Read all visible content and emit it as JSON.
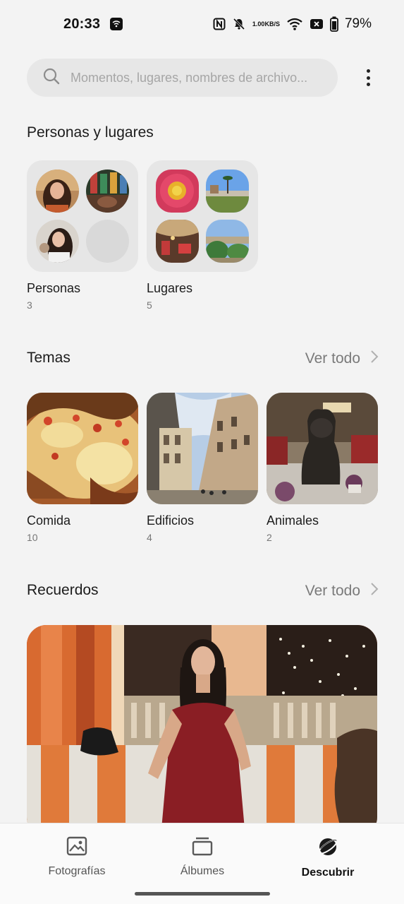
{
  "status_bar": {
    "time": "20:33",
    "speed_value": "1.00",
    "speed_unit": "KB/S",
    "battery": "79%"
  },
  "search": {
    "placeholder": "Momentos, lugares, nombres de archivo..."
  },
  "people_places": {
    "title": "Personas y lugares",
    "items": [
      {
        "label": "Personas",
        "count": "3"
      },
      {
        "label": "Lugares",
        "count": "5"
      }
    ]
  },
  "themes": {
    "title": "Temas",
    "see_all": "Ver todo",
    "items": [
      {
        "label": "Comida",
        "count": "10"
      },
      {
        "label": "Edificios",
        "count": "4"
      },
      {
        "label": "Animales",
        "count": "2"
      }
    ]
  },
  "memories": {
    "title": "Recuerdos",
    "see_all": "Ver todo"
  },
  "bottom_nav": {
    "items": [
      {
        "label": "Fotografías",
        "icon": "photo-icon",
        "active": false
      },
      {
        "label": "Álbumes",
        "icon": "albums-icon",
        "active": false
      },
      {
        "label": "Descubrir",
        "icon": "planet-icon",
        "active": true
      }
    ]
  },
  "colors": {
    "background": "#f3f3f3",
    "accent_text": "#1c1c1c",
    "muted_text": "#7a7a7a"
  }
}
